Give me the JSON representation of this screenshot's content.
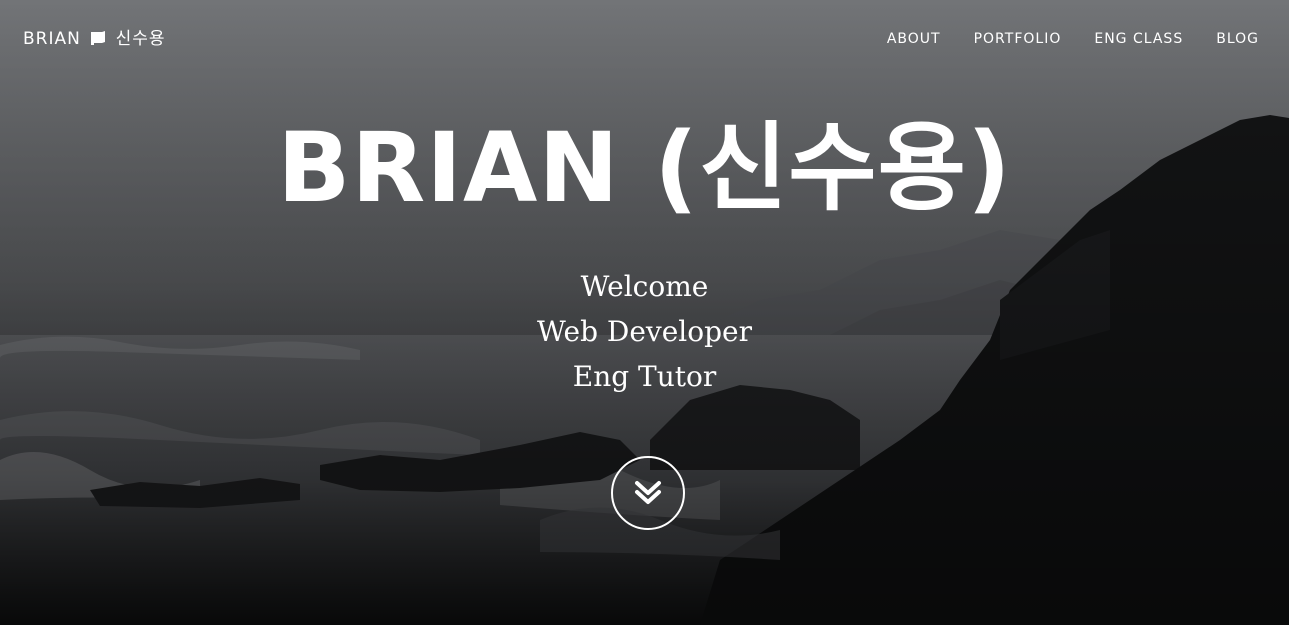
{
  "brand": {
    "label": "BRIAN 🏴 신수용",
    "text_before_icon": "BRIAN",
    "text_after_icon": "신수용",
    "icon": "flag-icon"
  },
  "nav": {
    "items": [
      {
        "label": "ABOUT"
      },
      {
        "label": "PORTFOLIO"
      },
      {
        "label": "ENG CLASS"
      },
      {
        "label": "BLOG"
      }
    ]
  },
  "hero": {
    "title": "BRIAN (신수용)",
    "subtitles": [
      "Welcome",
      "Web Developer",
      "Eng Tutor"
    ],
    "scroll_icon": "double-chevron-down-icon"
  },
  "colors": {
    "text": "#ffffff",
    "sky": "#6e7073",
    "rocks": "#151617"
  }
}
